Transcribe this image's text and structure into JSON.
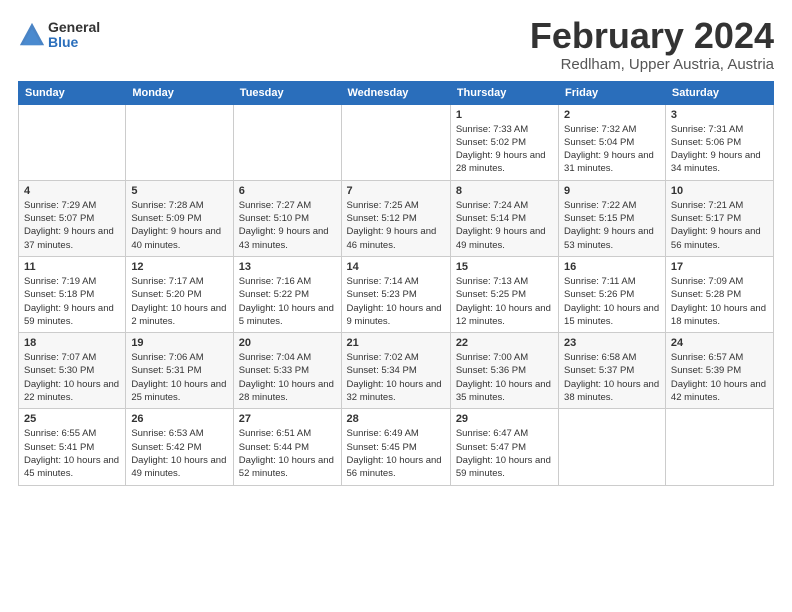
{
  "logo": {
    "general": "General",
    "blue": "Blue"
  },
  "title": "February 2024",
  "location": "Redlham, Upper Austria, Austria",
  "days_of_week": [
    "Sunday",
    "Monday",
    "Tuesday",
    "Wednesday",
    "Thursday",
    "Friday",
    "Saturday"
  ],
  "weeks": [
    [
      {
        "day": "",
        "info": ""
      },
      {
        "day": "",
        "info": ""
      },
      {
        "day": "",
        "info": ""
      },
      {
        "day": "",
        "info": ""
      },
      {
        "day": "1",
        "info": "Sunrise: 7:33 AM\nSunset: 5:02 PM\nDaylight: 9 hours and 28 minutes."
      },
      {
        "day": "2",
        "info": "Sunrise: 7:32 AM\nSunset: 5:04 PM\nDaylight: 9 hours and 31 minutes."
      },
      {
        "day": "3",
        "info": "Sunrise: 7:31 AM\nSunset: 5:06 PM\nDaylight: 9 hours and 34 minutes."
      }
    ],
    [
      {
        "day": "4",
        "info": "Sunrise: 7:29 AM\nSunset: 5:07 PM\nDaylight: 9 hours and 37 minutes."
      },
      {
        "day": "5",
        "info": "Sunrise: 7:28 AM\nSunset: 5:09 PM\nDaylight: 9 hours and 40 minutes."
      },
      {
        "day": "6",
        "info": "Sunrise: 7:27 AM\nSunset: 5:10 PM\nDaylight: 9 hours and 43 minutes."
      },
      {
        "day": "7",
        "info": "Sunrise: 7:25 AM\nSunset: 5:12 PM\nDaylight: 9 hours and 46 minutes."
      },
      {
        "day": "8",
        "info": "Sunrise: 7:24 AM\nSunset: 5:14 PM\nDaylight: 9 hours and 49 minutes."
      },
      {
        "day": "9",
        "info": "Sunrise: 7:22 AM\nSunset: 5:15 PM\nDaylight: 9 hours and 53 minutes."
      },
      {
        "day": "10",
        "info": "Sunrise: 7:21 AM\nSunset: 5:17 PM\nDaylight: 9 hours and 56 minutes."
      }
    ],
    [
      {
        "day": "11",
        "info": "Sunrise: 7:19 AM\nSunset: 5:18 PM\nDaylight: 9 hours and 59 minutes."
      },
      {
        "day": "12",
        "info": "Sunrise: 7:17 AM\nSunset: 5:20 PM\nDaylight: 10 hours and 2 minutes."
      },
      {
        "day": "13",
        "info": "Sunrise: 7:16 AM\nSunset: 5:22 PM\nDaylight: 10 hours and 5 minutes."
      },
      {
        "day": "14",
        "info": "Sunrise: 7:14 AM\nSunset: 5:23 PM\nDaylight: 10 hours and 9 minutes."
      },
      {
        "day": "15",
        "info": "Sunrise: 7:13 AM\nSunset: 5:25 PM\nDaylight: 10 hours and 12 minutes."
      },
      {
        "day": "16",
        "info": "Sunrise: 7:11 AM\nSunset: 5:26 PM\nDaylight: 10 hours and 15 minutes."
      },
      {
        "day": "17",
        "info": "Sunrise: 7:09 AM\nSunset: 5:28 PM\nDaylight: 10 hours and 18 minutes."
      }
    ],
    [
      {
        "day": "18",
        "info": "Sunrise: 7:07 AM\nSunset: 5:30 PM\nDaylight: 10 hours and 22 minutes."
      },
      {
        "day": "19",
        "info": "Sunrise: 7:06 AM\nSunset: 5:31 PM\nDaylight: 10 hours and 25 minutes."
      },
      {
        "day": "20",
        "info": "Sunrise: 7:04 AM\nSunset: 5:33 PM\nDaylight: 10 hours and 28 minutes."
      },
      {
        "day": "21",
        "info": "Sunrise: 7:02 AM\nSunset: 5:34 PM\nDaylight: 10 hours and 32 minutes."
      },
      {
        "day": "22",
        "info": "Sunrise: 7:00 AM\nSunset: 5:36 PM\nDaylight: 10 hours and 35 minutes."
      },
      {
        "day": "23",
        "info": "Sunrise: 6:58 AM\nSunset: 5:37 PM\nDaylight: 10 hours and 38 minutes."
      },
      {
        "day": "24",
        "info": "Sunrise: 6:57 AM\nSunset: 5:39 PM\nDaylight: 10 hours and 42 minutes."
      }
    ],
    [
      {
        "day": "25",
        "info": "Sunrise: 6:55 AM\nSunset: 5:41 PM\nDaylight: 10 hours and 45 minutes."
      },
      {
        "day": "26",
        "info": "Sunrise: 6:53 AM\nSunset: 5:42 PM\nDaylight: 10 hours and 49 minutes."
      },
      {
        "day": "27",
        "info": "Sunrise: 6:51 AM\nSunset: 5:44 PM\nDaylight: 10 hours and 52 minutes."
      },
      {
        "day": "28",
        "info": "Sunrise: 6:49 AM\nSunset: 5:45 PM\nDaylight: 10 hours and 56 minutes."
      },
      {
        "day": "29",
        "info": "Sunrise: 6:47 AM\nSunset: 5:47 PM\nDaylight: 10 hours and 59 minutes."
      },
      {
        "day": "",
        "info": ""
      },
      {
        "day": "",
        "info": ""
      }
    ]
  ]
}
